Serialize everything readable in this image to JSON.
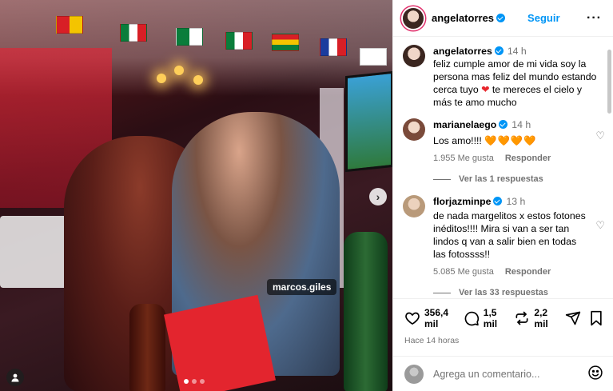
{
  "photo": {
    "tag_username": "marcos.giles",
    "carousel_dots": 3,
    "active_dot": 0
  },
  "header": {
    "username": "angelatorres",
    "follow_label": "Seguir",
    "more_icon": "more-horizontal-icon"
  },
  "caption": {
    "username": "angelatorres",
    "time": "14 h",
    "text_part1": "feliz cumple amor de mi vida soy la persona mas feliz del mundo estando cerca tuyo",
    "heart": "❤",
    "text_part2": "te mereces el cielo y más te amo mucho"
  },
  "comments": [
    {
      "username": "marianelaego",
      "time": "14 h",
      "text": "Los amo!!!!",
      "emoji": "🧡🧡🧡🧡",
      "likes": "1.955 Me gusta",
      "reply_label": "Responder",
      "view_replies": "Ver las 1 respuestas"
    },
    {
      "username": "florjazminpe",
      "time": "13 h",
      "text": "de nada margelitos x estos fotones inéditos!!!! Mira si van a ser tan lindos q van a salir bien en todas las fotossss!!",
      "emoji": "",
      "likes": "5.085 Me gusta",
      "reply_label": "Responder",
      "view_replies": "Ver las 33 respuestas"
    }
  ],
  "actions": {
    "likes": "356,4 mil",
    "comments": "1,5 mil",
    "reposts": "2,2 mil",
    "posted": "Hace 14 horas"
  },
  "compose": {
    "placeholder": "Agrega un comentario..."
  },
  "colors": {
    "accent": "#0095f6",
    "muted": "#737373",
    "heart": "#e8272d"
  }
}
